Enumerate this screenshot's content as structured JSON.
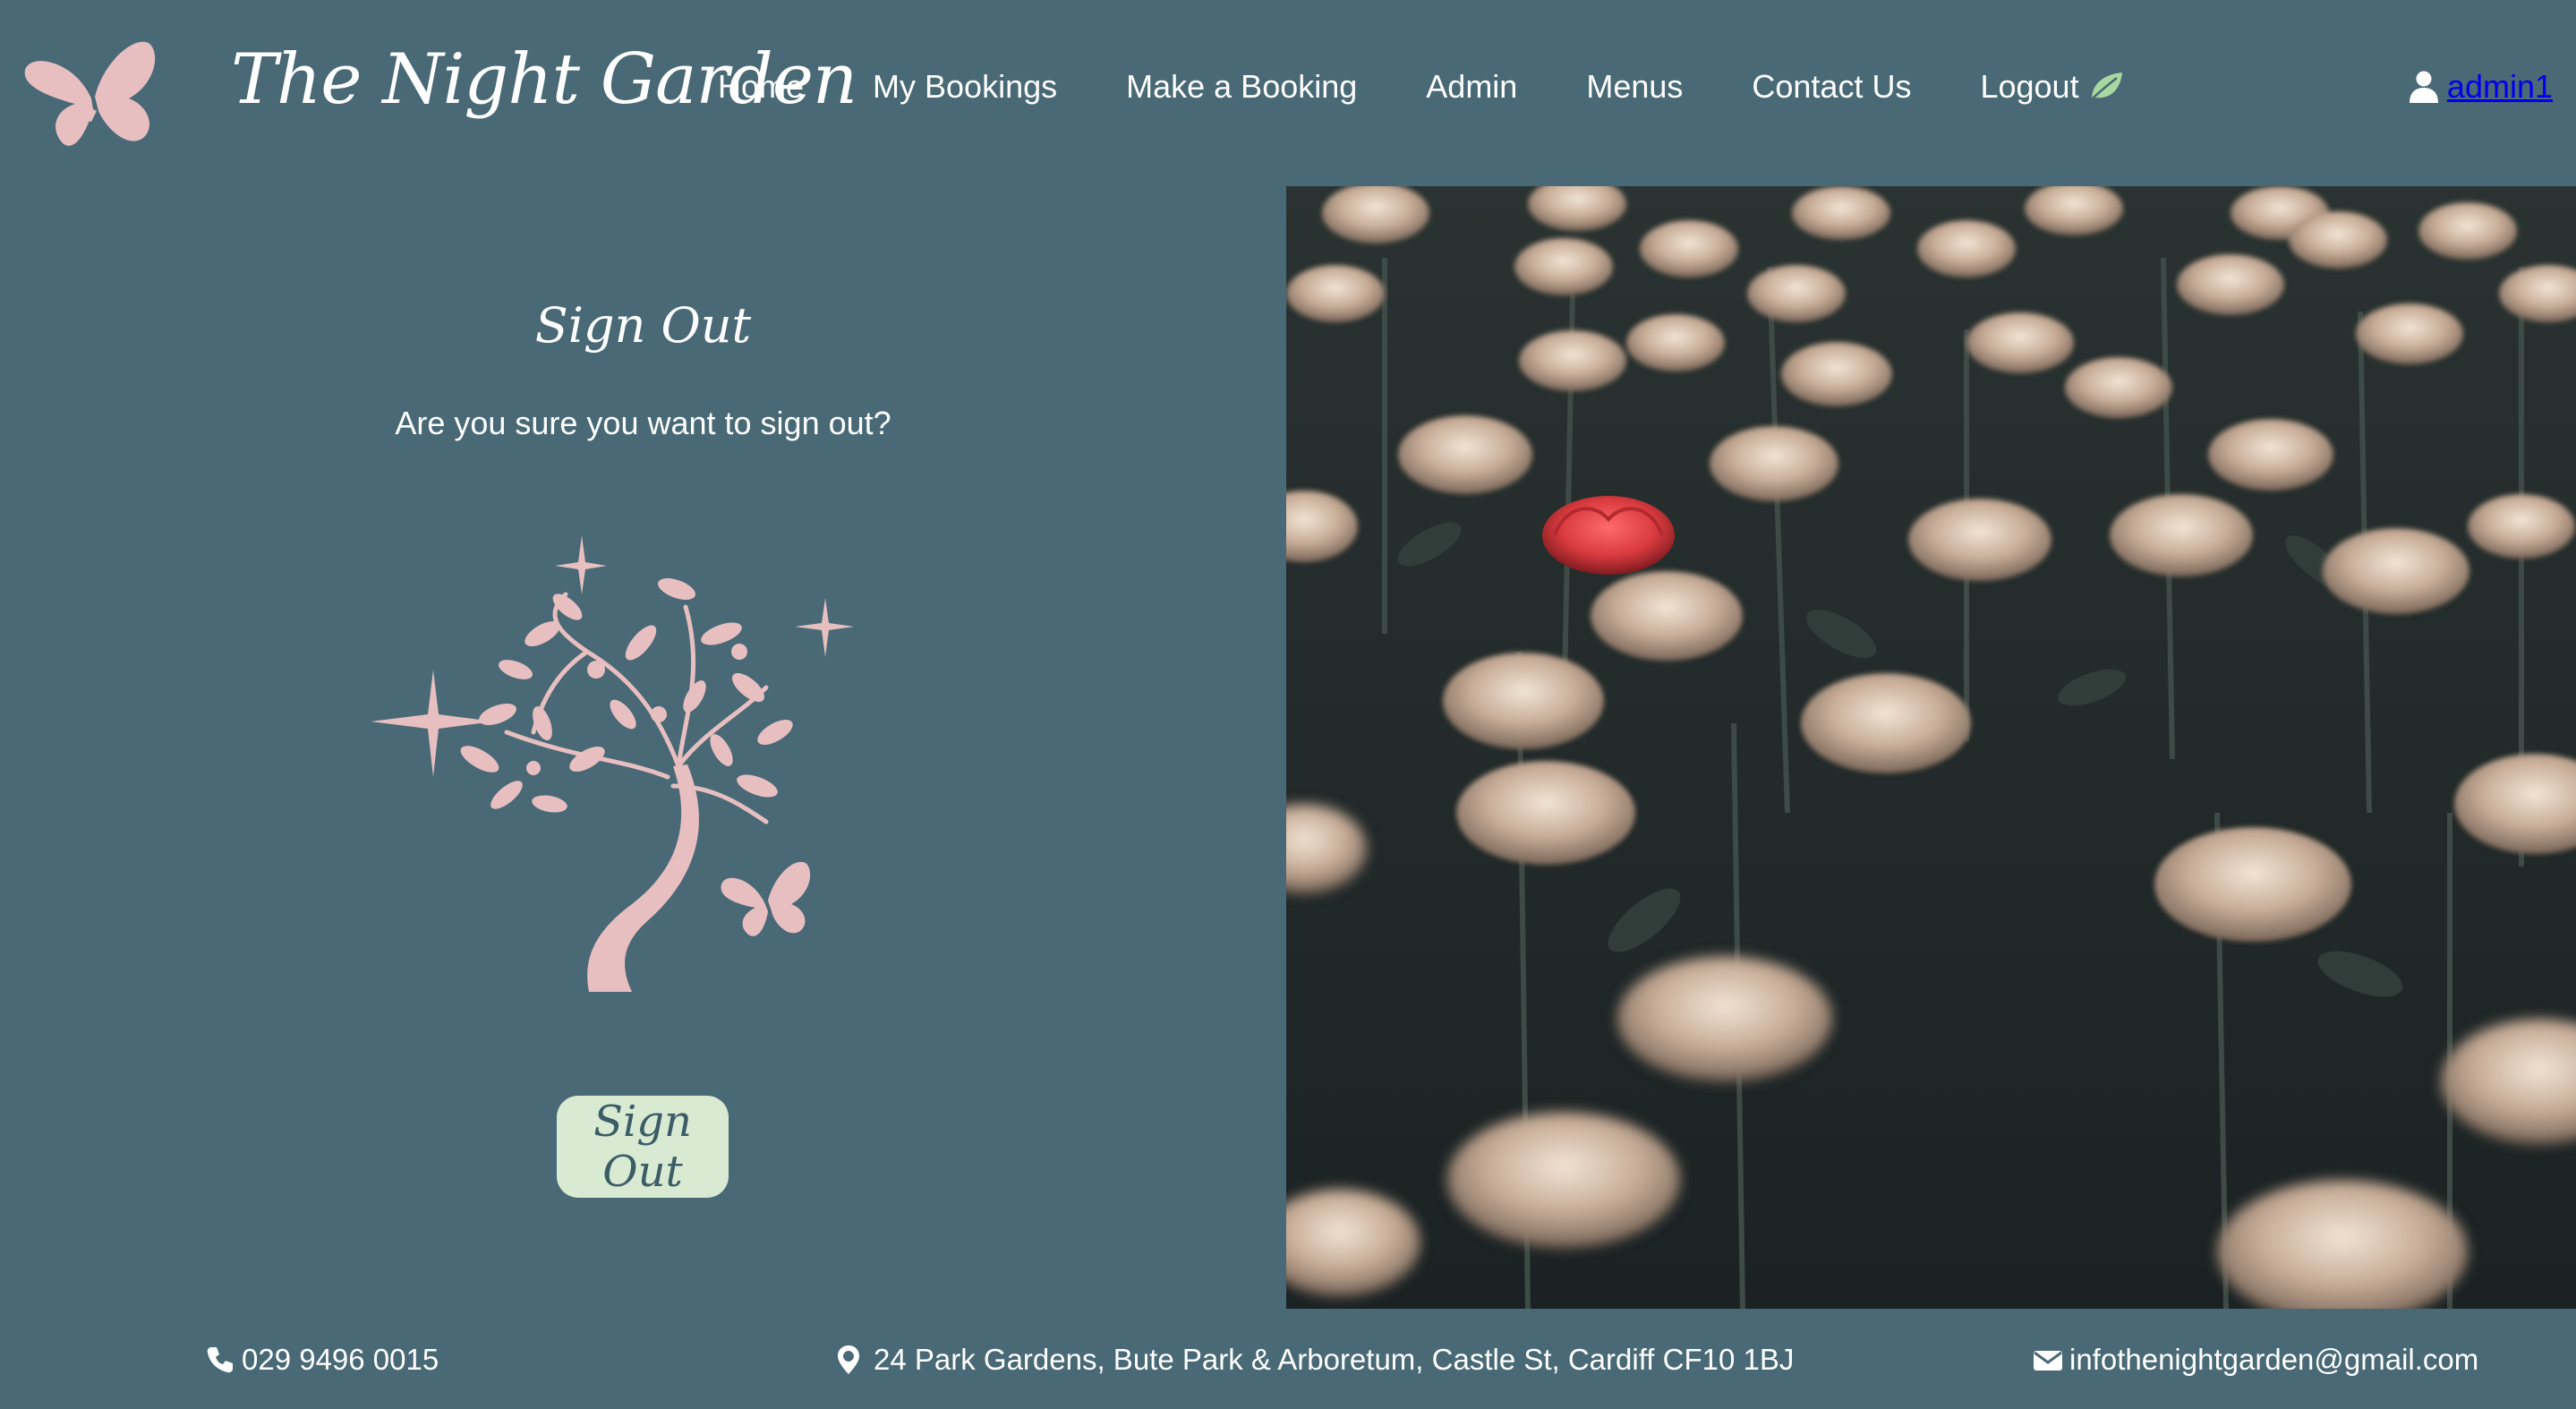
{
  "brand": {
    "name": "The Night Garden",
    "logo_icon": "butterfly-icon"
  },
  "nav": {
    "items": [
      {
        "label": "Home"
      },
      {
        "label": "My Bookings"
      },
      {
        "label": "Make a Booking"
      },
      {
        "label": "Admin"
      },
      {
        "label": "Menus"
      },
      {
        "label": "Contact Us"
      },
      {
        "label": "Logout",
        "icon": "leaf-icon"
      }
    ],
    "user": {
      "icon": "user-icon",
      "name": "admin1"
    }
  },
  "signout": {
    "title": "Sign Out",
    "question": "Are you sure you want to sign out?",
    "illustration": "tree-with-butterfly-and-sparkles",
    "button_label": "Sign Out"
  },
  "hero": {
    "subject": "field of glowing pale roses with one red rose"
  },
  "footer": {
    "phone": {
      "icon": "phone-icon",
      "text": "029 9496 0015"
    },
    "address": {
      "icon": "map-pin-icon",
      "text": "24 Park Gardens, Bute Park & Arboretum, Castle St, Cardiff CF10 1BJ"
    },
    "email": {
      "icon": "envelope-icon",
      "text": "infothenightgarden@gmail.com"
    }
  },
  "colors": {
    "background": "#486975",
    "accent_pink": "#e8bfc0",
    "button_bg": "#d9ead3",
    "button_text": "#3c5c66",
    "leaf_green": "#a8d8a0"
  }
}
